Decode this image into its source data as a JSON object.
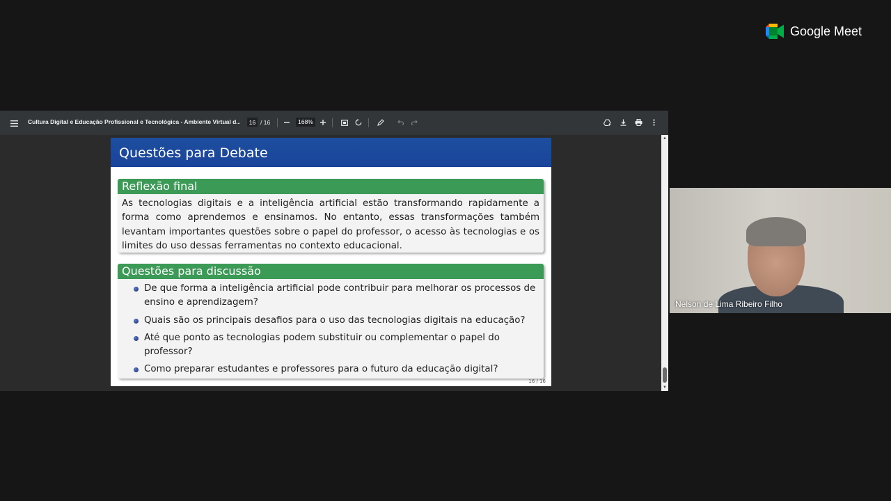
{
  "viewer": {
    "doc_title": "Cultura Digital e Educação Profissional e Tecnológica - Ambiente Virtual d...",
    "page_current": "16",
    "page_total": "/ 16",
    "zoom": "168%"
  },
  "slide": {
    "title": "Questões para Debate",
    "block1": {
      "heading": "Reflexão final",
      "text": "As tecnologias digitais e a inteligência artificial estão transformando rapidamente a forma como aprendemos e ensinamos. No entanto, essas transformações também levantam importantes questões sobre o papel do professor, o acesso às tecnologias e os limites do uso dessas ferramentas no contexto educacional."
    },
    "block2": {
      "heading": "Questões para discussão",
      "items": [
        "De que forma a inteligência artificial pode contribuir para melhorar os processos de ensino e aprendizagem?",
        "Quais são os principais desafios para o uso das tecnologias digitais na educação?",
        "Até que ponto as tecnologias podem substituir ou complementar o papel do professor?",
        "Como preparar estudantes e professores para o futuro da educação digital?"
      ]
    },
    "page_number": "16 / 16"
  },
  "meet": {
    "brand": "Google Meet",
    "participant_name": "Nelson de Lima Ribeiro Filho"
  },
  "colors": {
    "slide_header": "#1a449c",
    "block_header": "#3c9a57",
    "toolbar": "#323639"
  }
}
